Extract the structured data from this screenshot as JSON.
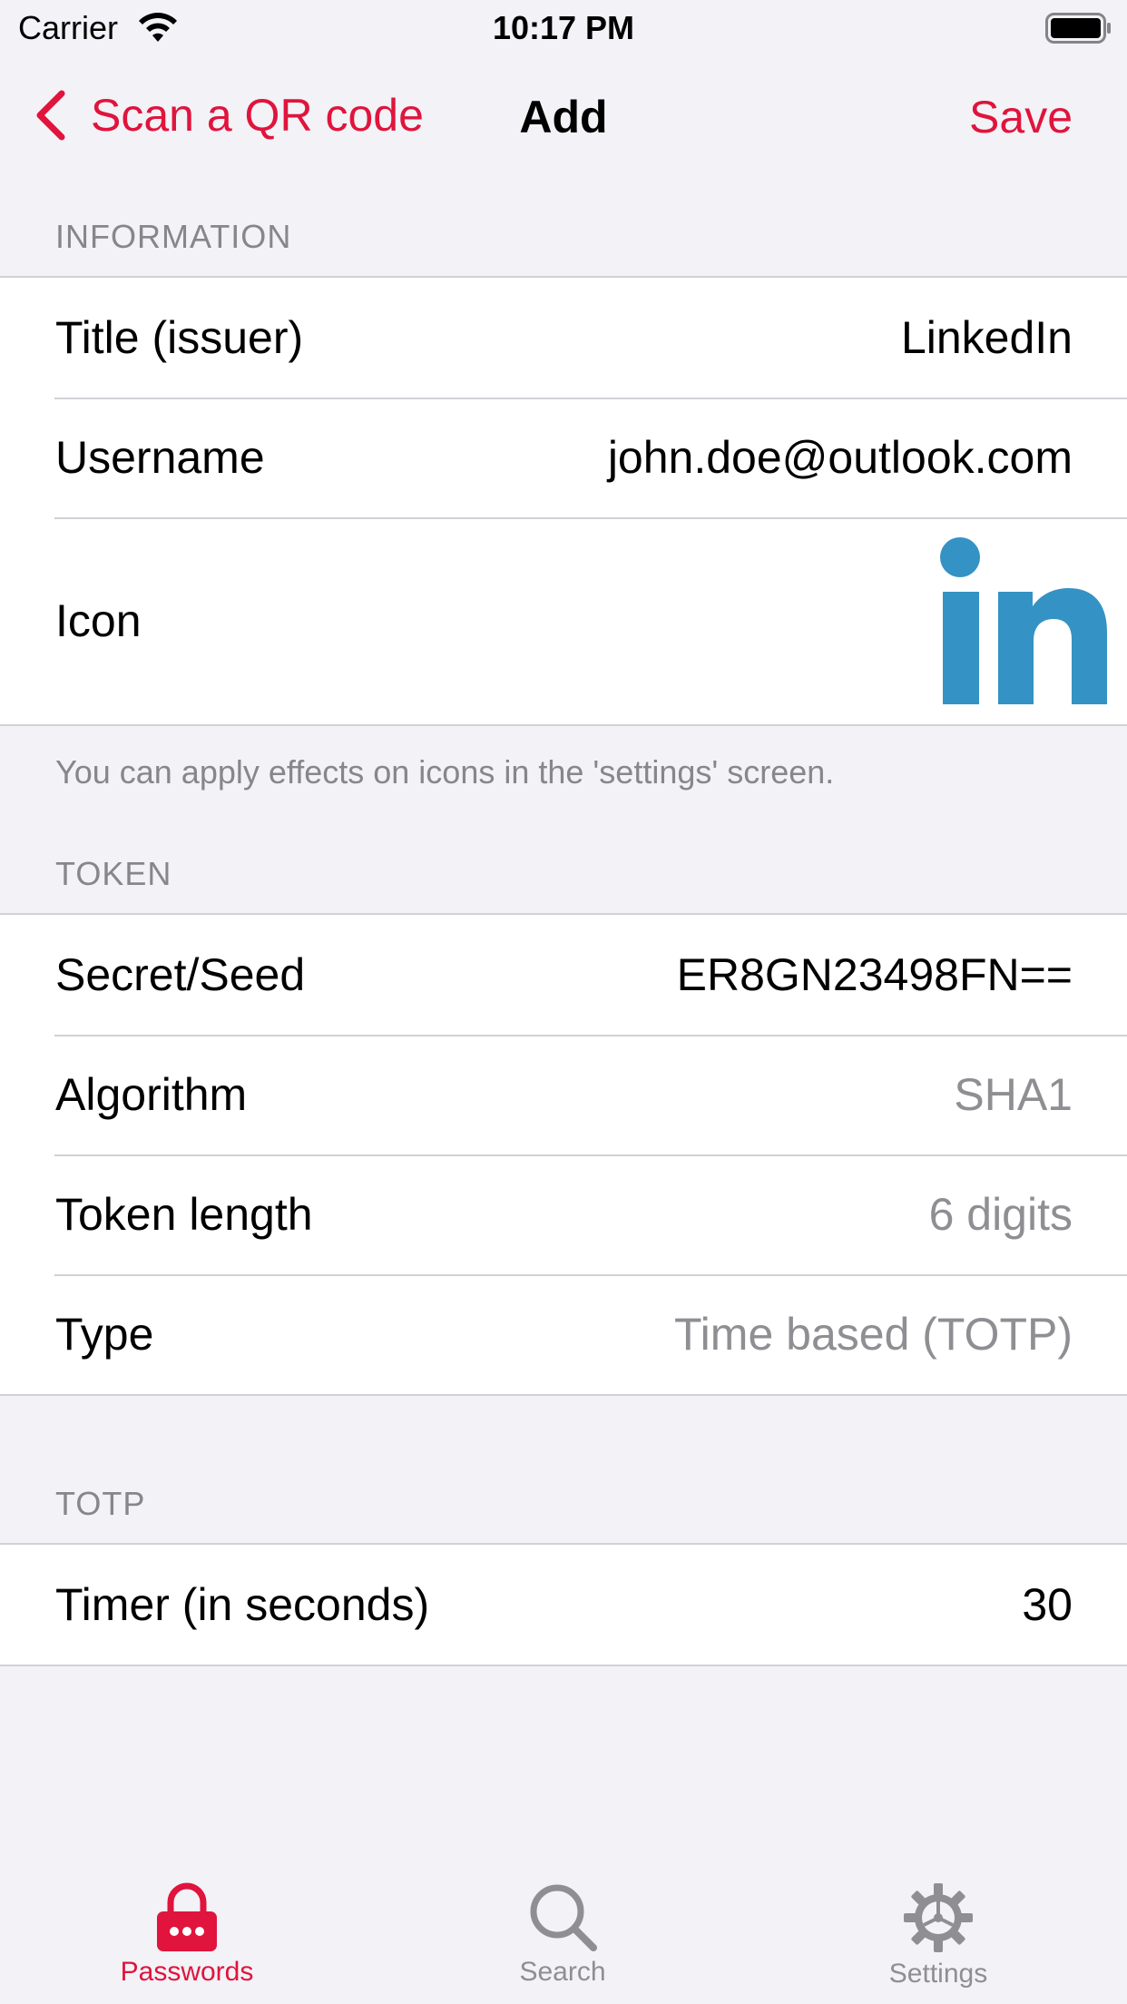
{
  "status_bar": {
    "carrier": "Carrier",
    "time": "10:17 PM"
  },
  "nav": {
    "back_label": "Scan a QR code",
    "title": "Add",
    "save_label": "Save"
  },
  "information": {
    "header": "INFORMATION",
    "rows": [
      {
        "label": "Title (issuer)",
        "value": "LinkedIn"
      },
      {
        "label": "Username",
        "value": "john.doe@outlook.com"
      },
      {
        "label": "Icon",
        "icon": "linkedin-logo-icon"
      }
    ],
    "footer": "You can apply effects on icons in the 'settings' screen."
  },
  "token": {
    "header": "TOKEN",
    "rows": [
      {
        "label": "Secret/Seed",
        "value": "ER8GN23498FN=="
      },
      {
        "label": "Algorithm",
        "value": "SHA1"
      },
      {
        "label": "Token length",
        "value": "6 digits"
      },
      {
        "label": "Type",
        "value": "Time based (TOTP)"
      }
    ]
  },
  "totp": {
    "header": "TOTP",
    "rows": [
      {
        "label": "Timer (in seconds)",
        "value": "30"
      }
    ]
  },
  "tab_bar": {
    "tabs": [
      {
        "label": "Passwords",
        "icon": "lock-icon",
        "active": true
      },
      {
        "label": "Search",
        "icon": "search-icon",
        "active": false
      },
      {
        "label": "Settings",
        "icon": "gear-icon",
        "active": false
      }
    ]
  },
  "colors": {
    "accent": "#e0143c",
    "linkedin": "#3592c4",
    "background": "#f2f2f7",
    "secondary_text": "#8e8e93"
  }
}
